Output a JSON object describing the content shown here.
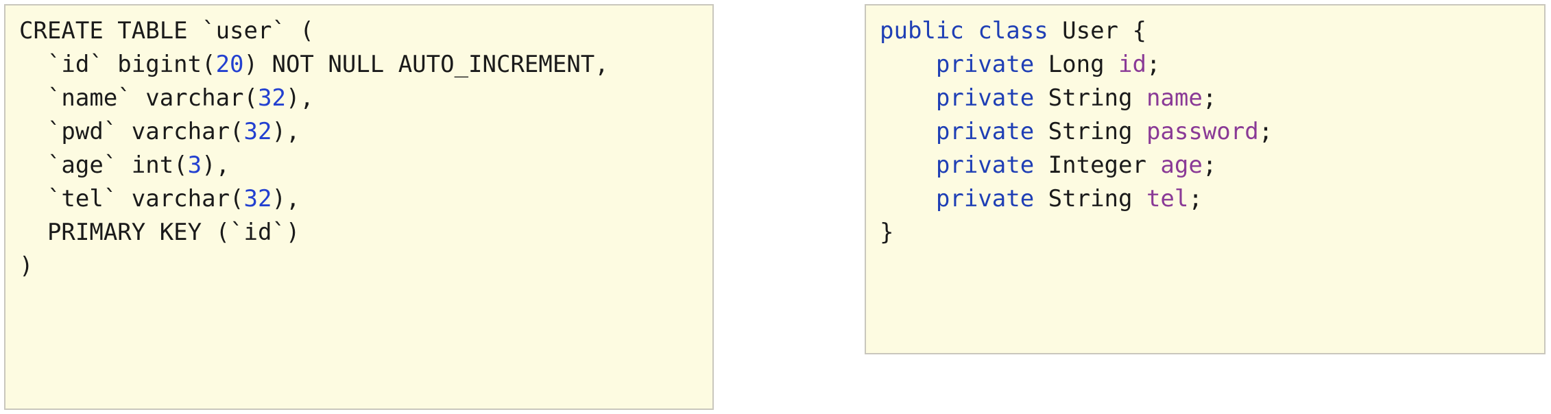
{
  "sql_block": {
    "lines": [
      [
        {
          "t": "CREATE TABLE `user` (",
          "k": "plain"
        }
      ],
      [
        {
          "t": "  `id` bigint(",
          "k": "plain"
        },
        {
          "t": "20",
          "k": "num"
        },
        {
          "t": ") NOT NULL AUTO_INCREMENT,",
          "k": "plain"
        }
      ],
      [
        {
          "t": "  `name` varchar(",
          "k": "plain"
        },
        {
          "t": "32",
          "k": "num"
        },
        {
          "t": "),",
          "k": "plain"
        }
      ],
      [
        {
          "t": "  `pwd` varchar(",
          "k": "plain"
        },
        {
          "t": "32",
          "k": "num"
        },
        {
          "t": "),",
          "k": "plain"
        }
      ],
      [
        {
          "t": "  `age` int(",
          "k": "plain"
        },
        {
          "t": "3",
          "k": "num"
        },
        {
          "t": "),",
          "k": "plain"
        }
      ],
      [
        {
          "t": "  `tel` varchar(",
          "k": "plain"
        },
        {
          "t": "32",
          "k": "num"
        },
        {
          "t": "),",
          "k": "plain"
        }
      ],
      [
        {
          "t": "  PRIMARY KEY (`id`)",
          "k": "plain"
        }
      ],
      [
        {
          "t": ")",
          "k": "plain"
        }
      ]
    ]
  },
  "java_block": {
    "lines": [
      [
        {
          "t": "public",
          "k": "kw"
        },
        {
          "t": " ",
          "k": "plain"
        },
        {
          "t": "class",
          "k": "kw"
        },
        {
          "t": " User {",
          "k": "plain"
        }
      ],
      [
        {
          "t": "    ",
          "k": "plain"
        },
        {
          "t": "private",
          "k": "kw"
        },
        {
          "t": " Long ",
          "k": "plain"
        },
        {
          "t": "id",
          "k": "field"
        },
        {
          "t": ";",
          "k": "plain"
        }
      ],
      [
        {
          "t": "    ",
          "k": "plain"
        },
        {
          "t": "private",
          "k": "kw"
        },
        {
          "t": " String ",
          "k": "plain"
        },
        {
          "t": "name",
          "k": "field"
        },
        {
          "t": ";",
          "k": "plain"
        }
      ],
      [
        {
          "t": "    ",
          "k": "plain"
        },
        {
          "t": "private",
          "k": "kw"
        },
        {
          "t": " String ",
          "k": "plain"
        },
        {
          "t": "password",
          "k": "field"
        },
        {
          "t": ";",
          "k": "plain"
        }
      ],
      [
        {
          "t": "    ",
          "k": "plain"
        },
        {
          "t": "private",
          "k": "kw"
        },
        {
          "t": " Integer ",
          "k": "plain"
        },
        {
          "t": "age",
          "k": "field"
        },
        {
          "t": ";",
          "k": "plain"
        }
      ],
      [
        {
          "t": "    ",
          "k": "plain"
        },
        {
          "t": "private",
          "k": "kw"
        },
        {
          "t": " String ",
          "k": "plain"
        },
        {
          "t": "tel",
          "k": "field"
        },
        {
          "t": ";",
          "k": "plain"
        }
      ],
      [
        {
          "t": "}",
          "k": "plain"
        }
      ]
    ]
  },
  "colors": {
    "panel_background": "#fdfbe1",
    "panel_border": "#c9c7bd",
    "keyword": "#1f3fb5",
    "number": "#2340d0",
    "field": "#8a3a96",
    "text": "#1a1a1a"
  }
}
